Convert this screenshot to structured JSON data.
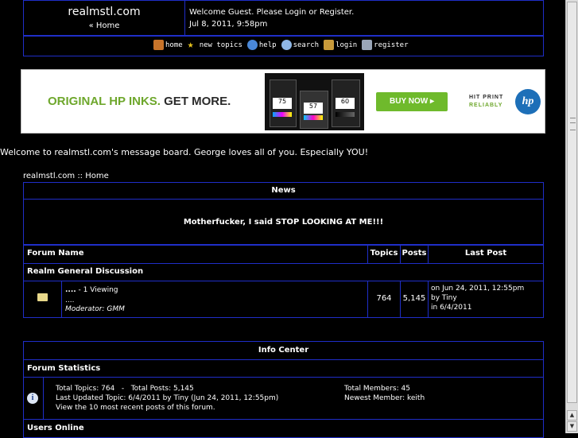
{
  "header": {
    "site_name": "realmstl.com",
    "home_link": "« Home",
    "welcome": "Welcome Guest. Please Login or Register.",
    "datetime": "Jul 8, 2011, 9:58pm"
  },
  "nav": [
    {
      "label": "home",
      "icon": "house-icon",
      "color": "#c8742a"
    },
    {
      "label": "new topics",
      "icon": "star-icon",
      "color": "#e6c21c"
    },
    {
      "label": "help",
      "icon": "help-icon",
      "color": "#4a88d8"
    },
    {
      "label": "search",
      "icon": "search-icon",
      "color": "#8fb7e6"
    },
    {
      "label": "login",
      "icon": "login-icon",
      "color": "#c89a3a"
    },
    {
      "label": "register",
      "icon": "register-icon",
      "color": "#9aa6b8"
    }
  ],
  "ad": {
    "headline_green": "ORIGINAL HP INKS.",
    "headline_dark": "GET MORE.",
    "button": "BUY NOW ▸",
    "tagline_1": "HIT PRINT",
    "tagline_2": "RELIABLY",
    "logo": "hp",
    "cartridges": [
      "75",
      "57",
      "60"
    ]
  },
  "intro": "Welcome to realmstl.com's message board. George loves all of you. Especially YOU!",
  "breadcrumb": "realmstl.com :: Home",
  "news": {
    "title": "News",
    "message": "Motherfucker, I said STOP LOOKING AT ME!!!"
  },
  "forum_table": {
    "headers": {
      "name": "Forum Name",
      "topics": "Topics",
      "posts": "Posts",
      "last": "Last Post"
    },
    "category": "Realm General Discussion",
    "row": {
      "title": "....",
      "viewing": " - 1 Viewing",
      "description": "....",
      "moderator": "Moderator: GMM",
      "topics": "764",
      "posts": "5,145",
      "last_date": "on Jun 24, 2011, 12:55pm",
      "last_by": "by Tiny",
      "last_in": "in 6/4/2011"
    }
  },
  "info_center": {
    "title": "Info Center",
    "stats_title": "Forum Statistics",
    "stats_line1": "Total Topics: 764   -   Total Posts: 5,145",
    "stats_line2": "Last Updated Topic: 6/4/2011 by Tiny (Jun 24, 2011, 12:55pm)",
    "stats_line3": "View the 10 most recent posts of this forum.",
    "members_total": "Total Members: 45",
    "members_newest": "Newest Member: keith",
    "users_online": "Users Online"
  }
}
